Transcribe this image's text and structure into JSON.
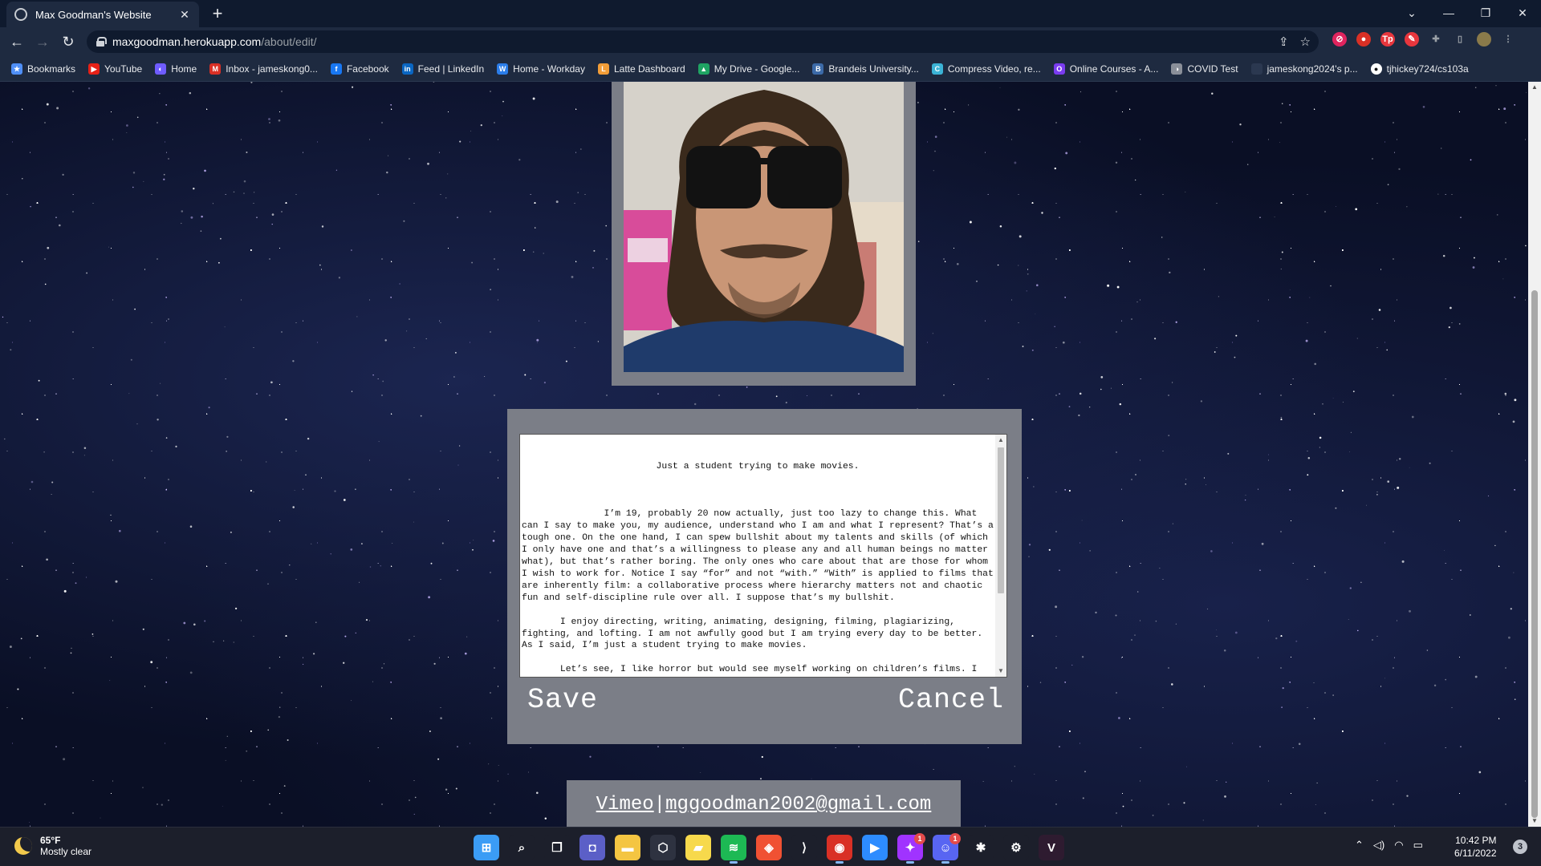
{
  "browser": {
    "tab_title": "Max Goodman's Website",
    "tab_close": "✕",
    "new_tab": "+",
    "url_domain": "maxgoodman.herokuapp.com",
    "url_path": "/about/edit/",
    "window_controls": {
      "dropdown": "⌄",
      "minimize": "—",
      "restore": "❐",
      "close": "✕"
    },
    "nav": {
      "back": "←",
      "forward": "→",
      "reload": "↻",
      "share": "⇪",
      "bookmark": "☆"
    }
  },
  "bookmarks": [
    {
      "label": "Bookmarks",
      "icon": "star-icon",
      "color": "#4f8ff7",
      "glyph": "★"
    },
    {
      "label": "YouTube",
      "icon": "youtube-icon",
      "color": "#e62117",
      "glyph": "▶"
    },
    {
      "label": "Home",
      "icon": "home-icon",
      "color": "#6f5cff",
      "glyph": "◐"
    },
    {
      "label": "Inbox - jameskong0...",
      "icon": "gmail-icon",
      "color": "#d93025",
      "glyph": "M"
    },
    {
      "label": "Facebook",
      "icon": "facebook-icon",
      "color": "#1877f2",
      "glyph": "f"
    },
    {
      "label": "Feed | LinkedIn",
      "icon": "linkedin-icon",
      "color": "#0a66c2",
      "glyph": "in"
    },
    {
      "label": "Home - Workday",
      "icon": "workday-icon",
      "color": "#2b7de9",
      "glyph": "W"
    },
    {
      "label": "Latte Dashboard",
      "icon": "latte-icon",
      "color": "#f29d38",
      "glyph": "L"
    },
    {
      "label": "My Drive - Google...",
      "icon": "drive-icon",
      "color": "#1fa463",
      "glyph": "▲"
    },
    {
      "label": "Brandeis University...",
      "icon": "brandeis-icon",
      "color": "#3c6aa8",
      "glyph": "B"
    },
    {
      "label": "Compress Video, re...",
      "icon": "compress-icon",
      "color": "#3bb3d6",
      "glyph": "C"
    },
    {
      "label": "Online Courses - A...",
      "icon": "courses-icon",
      "color": "#7a3cf0",
      "glyph": "O"
    },
    {
      "label": "COVID Test",
      "icon": "covid-icon",
      "color": "#8a8f99",
      "glyph": "◑"
    },
    {
      "label": "jameskong2024's p...",
      "icon": "page-icon",
      "color": "#2b3850",
      "glyph": ""
    },
    {
      "label": "tjhickey724/cs103a",
      "icon": "github-icon",
      "color": "#ffffff",
      "glyph": "●"
    }
  ],
  "extensions": [
    {
      "name": "ext-block-icon",
      "color": "#e0245e",
      "glyph": "⊘"
    },
    {
      "name": "ext-shield-icon",
      "color": "#d93025",
      "glyph": "●"
    },
    {
      "name": "ext-tp-icon",
      "color": "#e8363d",
      "glyph": "Tp"
    },
    {
      "name": "ext-pen-icon",
      "color": "#e8363d",
      "glyph": "✎"
    },
    {
      "name": "puzzle-icon",
      "color": "#9aa0a6",
      "glyph": "✚"
    },
    {
      "name": "sidepanel-icon",
      "color": "#9aa0a6",
      "glyph": "▯"
    },
    {
      "name": "profile-avatar",
      "color": "#8a7a4a",
      "glyph": ""
    },
    {
      "name": "menu-icon",
      "color": "#9aa0a6",
      "glyph": "⋮"
    }
  ],
  "about_edit": {
    "title_line": "Just a student trying to make movies.",
    "paragraphs": [
      "       I’m 19, probably 20 now actually, just too lazy to change this. What can I say to make you, my audience, understand who I am and what I represent? That’s a tough one. On the one hand, I can spew bullshit about my talents and skills (of which I only have one and that’s a willingness to please any and all human beings no matter what), but that’s rather boring. The only ones who care about that are those for whom I wish to work for. Notice I say “for” and not “with.” “With” is applied to films that are inherently film: a collaborative process where hierarchy matters not and chaotic fun and self-discipline rule over all. I suppose that’s my bullshit.",
      "       I enjoy directing, writing, animating, designing, filming, plagiarizing, fighting, and lofting. I am not awfully good but I am trying every day to be better. As I said, I’m just a student trying to make movies.",
      "       Let’s see, I like horror but would see myself working on children’s films. I have huge respect for successfully cinematic children’s films (and no I don’t mean if Christopher Nolan directed Finding Nemo). I often write in tangents and roughly because it feels most pure and honest… and pretentious."
    ],
    "save_label": "Save",
    "cancel_label": "Cancel"
  },
  "footer": {
    "vimeo": "Vimeo",
    "separator": "|",
    "email": "mggoodman2002@gmail.com"
  },
  "taskbar": {
    "temperature": "65°F",
    "weather": "Mostly clear",
    "apps": [
      {
        "name": "start-icon",
        "color": "#3b9cf5",
        "glyph": "⊞",
        "active": false,
        "badge": ""
      },
      {
        "name": "search-icon",
        "color": "#1c1f2b",
        "glyph": "⌕",
        "active": false,
        "badge": ""
      },
      {
        "name": "task-view-icon",
        "color": "#1c1f2b",
        "glyph": "❐",
        "active": false,
        "badge": ""
      },
      {
        "name": "teams-chat-icon",
        "color": "#5b5fc7",
        "glyph": "◘",
        "active": false,
        "badge": ""
      },
      {
        "name": "file-explorer-icon",
        "color": "#f4c542",
        "glyph": "▬",
        "active": false,
        "badge": ""
      },
      {
        "name": "unity-icon",
        "color": "#2e3240",
        "glyph": "⬡",
        "active": false,
        "badge": ""
      },
      {
        "name": "sticky-notes-icon",
        "color": "#f7d94c",
        "glyph": "▰",
        "active": false,
        "badge": ""
      },
      {
        "name": "spotify-icon",
        "color": "#1db954",
        "glyph": "≋",
        "active": true,
        "badge": ""
      },
      {
        "name": "git-icon",
        "color": "#f05133",
        "glyph": "◈",
        "active": false,
        "badge": ""
      },
      {
        "name": "vscode-icon",
        "color": "#1c1f2b",
        "glyph": "⟩",
        "active": false,
        "badge": ""
      },
      {
        "name": "chrome-icon",
        "color": "#d93025",
        "glyph": "◉",
        "active": true,
        "badge": ""
      },
      {
        "name": "zoom-icon",
        "color": "#2d8cff",
        "glyph": "▶",
        "active": false,
        "badge": ""
      },
      {
        "name": "messenger-icon",
        "color": "#a033ff",
        "glyph": "✦",
        "active": true,
        "badge": "1"
      },
      {
        "name": "discord-icon",
        "color": "#5865f2",
        "glyph": "☺",
        "active": true,
        "badge": "1"
      },
      {
        "name": "slack-icon",
        "color": "#1c1f2b",
        "glyph": "✱",
        "active": false,
        "badge": ""
      },
      {
        "name": "steam-icon",
        "color": "#1c1f2b",
        "glyph": "⚙",
        "active": false,
        "badge": ""
      },
      {
        "name": "vegas-icon",
        "color": "#2e1b30",
        "glyph": "V",
        "active": false,
        "badge": ""
      }
    ],
    "tray": {
      "chevron": "⌃",
      "speaker": "🔈",
      "wifi": "◠",
      "volume": "◁)",
      "battery": "▭"
    },
    "time": "10:42 PM",
    "date": "6/11/2022",
    "notifications": "3"
  }
}
